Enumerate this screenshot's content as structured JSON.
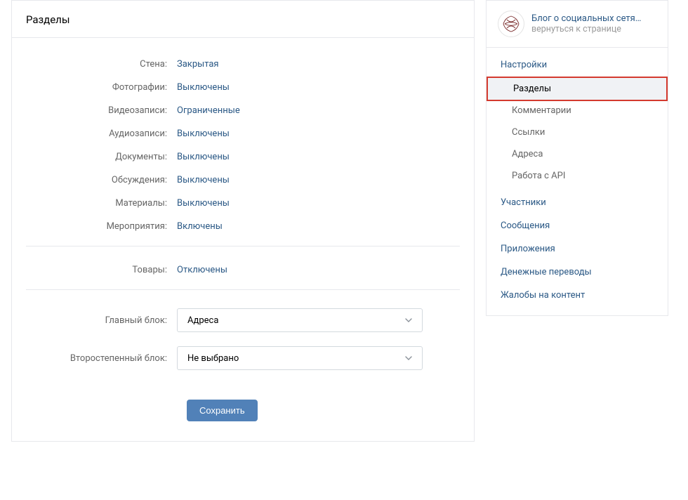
{
  "main": {
    "title": "Разделы",
    "sections": [
      {
        "label": "Стена:",
        "value": "Закрытая"
      },
      {
        "label": "Фотографии:",
        "value": "Выключены"
      },
      {
        "label": "Видеозаписи:",
        "value": "Ограниченные"
      },
      {
        "label": "Аудиозаписи:",
        "value": "Выключены"
      },
      {
        "label": "Документы:",
        "value": "Выключены"
      },
      {
        "label": "Обсуждения:",
        "value": "Выключены"
      },
      {
        "label": "Материалы:",
        "value": "Выключены"
      },
      {
        "label": "Мероприятия:",
        "value": "Включены"
      }
    ],
    "goods": {
      "label": "Товары:",
      "value": "Отключены"
    },
    "main_block": {
      "label": "Главный блок:",
      "value": "Адреса"
    },
    "secondary_block": {
      "label": "Второстепенный блок:",
      "value": "Не выбрано"
    },
    "save_label": "Сохранить"
  },
  "sidebar": {
    "title": "Блог о социальных сетя…",
    "back": "вернуться к странице",
    "settings_label": "Настройки",
    "subitems": [
      {
        "label": "Разделы",
        "active": true
      },
      {
        "label": "Комментарии",
        "active": false
      },
      {
        "label": "Ссылки",
        "active": false
      },
      {
        "label": "Адреса",
        "active": false
      },
      {
        "label": "Работа с API",
        "active": false
      }
    ],
    "items": [
      "Участники",
      "Сообщения",
      "Приложения",
      "Денежные переводы",
      "Жалобы на контент"
    ]
  }
}
